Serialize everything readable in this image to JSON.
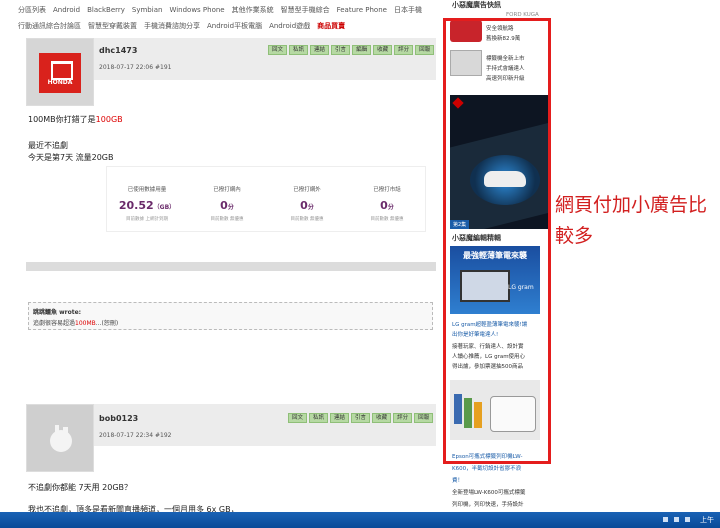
{
  "nav": {
    "row1": [
      "分區列表",
      "Android",
      "BlackBerry",
      "Symbian",
      "Windows Phone",
      "其他作業系統",
      "智慧型手機綜合",
      "Feature Phone",
      "日本手機"
    ],
    "row2": [
      "行動通訊綜合討論區",
      "智慧型穿戴裝置",
      "手機消費諮詢分享",
      "Android平板電腦",
      "Android遊戲",
      "商品買賣"
    ]
  },
  "post_actions": [
    "回文",
    "私訊",
    "連結",
    "引言",
    "編輯",
    "收藏",
    "評分",
    "回報"
  ],
  "post_actions2": [
    "回文",
    "私訊",
    "連結",
    "引言",
    "收藏",
    "評分",
    "回報"
  ],
  "post1": {
    "user": "dhc1473",
    "avatar_text": "HONDA",
    "meta": "2018-07-17 22:06  #191",
    "line1_a": "100MB你打錯了是",
    "line1_b": "100GB",
    "line2": "最近不追劇",
    "line3": "今天是第7天 流量20GB"
  },
  "stats": [
    {
      "label": "已使用數據用量",
      "value": "20.52",
      "unit": "（GB）",
      "sub": "目前數據 上網計到期"
    },
    {
      "label": "已撥打網內",
      "value": "0",
      "unit": "分",
      "sub": "目前數數 無優惠"
    },
    {
      "label": "已撥打網外",
      "value": "0",
      "unit": "分",
      "sub": "目前數數 無優惠"
    },
    {
      "label": "已撥打市話",
      "value": "0",
      "unit": "分",
      "sub": "目前數數 無優惠"
    }
  ],
  "quote": {
    "header": "跳跳鱷魚 wrote:",
    "body_a": "追劇很容易超過",
    "body_b": "100MB",
    "body_c": "...(恕刪)"
  },
  "post2": {
    "user": "bob0123",
    "meta": "2018-07-17 22:34  #192",
    "line1": "不追劇你都能 7天用 20GB？",
    "line2": "我也不追劇，頂多是看新聞直播頻道，一個月用多 6x GB，"
  },
  "sidebar": {
    "title": "小惡魔廣告快訊",
    "car_name": "FORD KUGA",
    "car_text1": "安全領航路",
    "car_text2": "舊換新82.9萬",
    "printer_text1": "標籤機全新上市",
    "printer_text2": "手持式會議達人",
    "printer_text3": "高速列印新升級",
    "lane_badge": "第2集",
    "title2": "小惡魔編輯精輯",
    "lg_head": "最強輕薄筆電來襲",
    "lg_brand": "LG gram",
    "lg_link": "LG gram超輕盈薄筆電來襲!讓",
    "lg_link2": "出你是好筆電達人!",
    "lg_desc1": "接著玩家、行銷達人、設計實",
    "lg_desc2": "人讀心推薦，LG gram使用心",
    "lg_desc3": "得出爐，參加票選抽500商品",
    "epson_link": "Epson可攜式標籤列印機LW-",
    "epson_link2": "K600，半截切設計省膠不浪",
    "epson_link3": "費！",
    "epson_desc1": "全新登場LW-K600可攜式標籤",
    "epson_desc2": "列印機，列印快速，手持設計"
  },
  "annotation": "網頁付加小廣告比較多",
  "taskbar": {
    "clock": "上午"
  }
}
